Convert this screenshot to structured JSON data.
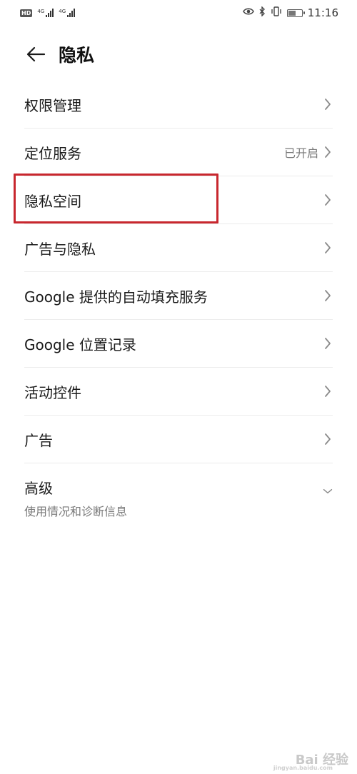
{
  "status_bar": {
    "hd_badge": "HD",
    "net1_label": "4G",
    "net2_label": "4G",
    "time": "11:16",
    "battery_level": 0.6
  },
  "header": {
    "title": "隐私"
  },
  "settings": {
    "items": [
      {
        "label": "权限管理",
        "status": ""
      },
      {
        "label": "定位服务",
        "status": "已开启"
      },
      {
        "label": "隐私空间",
        "status": ""
      },
      {
        "label": "广告与隐私",
        "status": ""
      },
      {
        "label": "Google 提供的自动填充服务",
        "status": ""
      },
      {
        "label": "Google 位置记录",
        "status": ""
      },
      {
        "label": "活动控件",
        "status": ""
      },
      {
        "label": "广告",
        "status": ""
      }
    ],
    "advanced": {
      "label": "高级",
      "subtitle": "使用情况和诊断信息"
    }
  },
  "annotation": {
    "color": "#c8272e"
  },
  "watermark": {
    "text": "Bai 经验",
    "sub": "jingyan.baidu.com"
  }
}
